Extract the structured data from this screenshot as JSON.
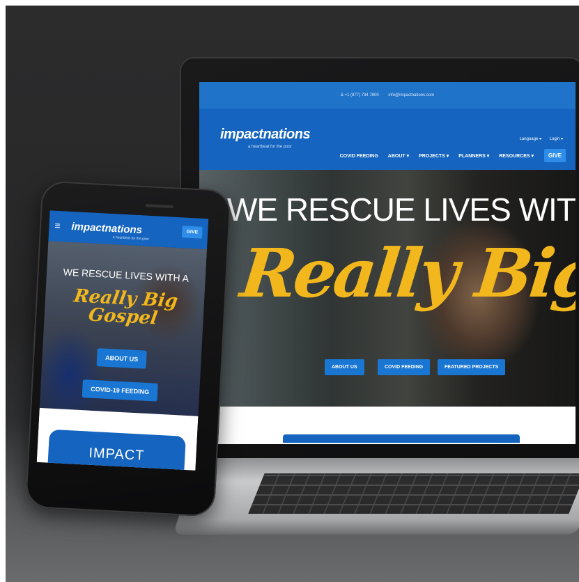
{
  "laptop": {
    "topbar": {
      "phone": "& +1 (877) 734 7800",
      "email": "info@impactnations.com"
    },
    "logo": "impactnations",
    "logo_sub": "a heartbeat for the poor",
    "util": {
      "language": "Language ▾",
      "login": "Login ▾"
    },
    "nav": [
      "COVID FEEDING",
      "ABOUT ▾",
      "PROJECTS ▾",
      "PLANNERS ▾",
      "RESOURCES ▾"
    ],
    "give": "GIVE",
    "hero_line1": "WE RESCUE LIVES WITH A",
    "hero_line2": "Really Big Gospel",
    "buttons": [
      "ABOUT US",
      "COVID FEEDING",
      "FEATURED PROJECTS"
    ]
  },
  "phone": {
    "menu_icon": "≡",
    "logo": "impactnations",
    "logo_sub": "a heartbeat for the poor",
    "give": "GIVE",
    "hero_line1": "WE RESCUE LIVES WITH A",
    "hero_line2": "Really Big Gospel",
    "buttons": [
      "ABOUT US",
      "COVID-19 FEEDING"
    ],
    "card_title": "IMPACT"
  },
  "colors": {
    "brand_blue": "#1565c0",
    "accent_gold": "#f2b71c",
    "button_blue": "#1976d2"
  }
}
